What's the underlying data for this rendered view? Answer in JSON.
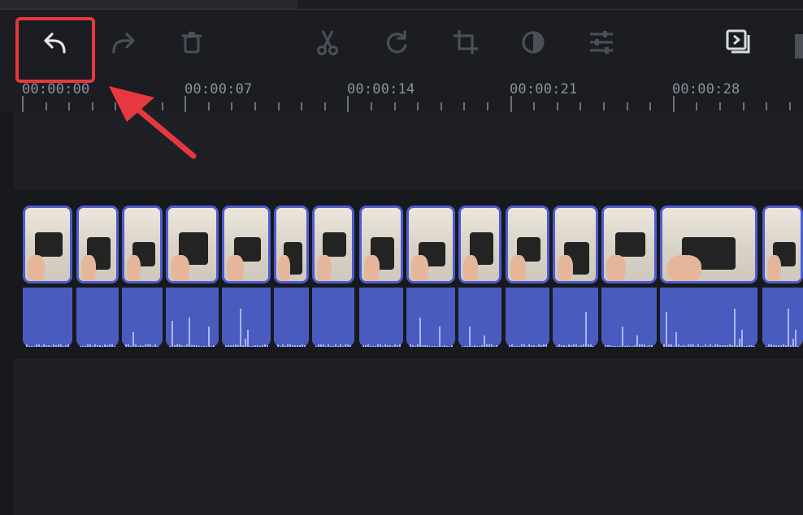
{
  "toolbar": {
    "undo": "undo-icon",
    "redo": "redo-icon",
    "delete": "trash-icon",
    "split": "scissors-icon",
    "rotate": "rotate-icon",
    "crop": "crop-icon",
    "color": "contrast-icon",
    "adjust": "sliders-icon",
    "transition": "transition-icon"
  },
  "timeline": {
    "ruler": [
      "00:00:00",
      "00:00:07",
      "00:00:14",
      "00:00:21",
      "00:00:28"
    ]
  },
  "colors": {
    "background": "#1b1d22",
    "clip_border": "#4d5cd0",
    "audio_fill": "#4a5bbf",
    "highlight": "#e8383f"
  }
}
